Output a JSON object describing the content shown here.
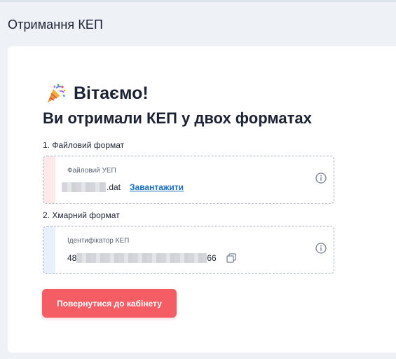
{
  "page": {
    "title": "Отримання КЕП"
  },
  "welcome": {
    "icon": "party-popper-icon",
    "heading": "Вітаємо!",
    "subtitle": "Ви отримали КЕП у двох форматах"
  },
  "file_format": {
    "section_label": "1. Файловий формат",
    "field_label": "Файловий УЕП",
    "file_extension": ".dat",
    "download_label": "Завантажити",
    "accent_color": "#fde9ea",
    "info_icon": "info-icon"
  },
  "cloud_format": {
    "section_label": "2. Хмарний формат",
    "field_label": "Ідентифікатор КЕП",
    "id_prefix": "48",
    "id_suffix": "66",
    "accent_color": "#e8f0fc",
    "copy_icon": "copy-icon",
    "info_icon": "info-icon"
  },
  "actions": {
    "back_label": "Повернутися до кабінету",
    "back_color": "#f45d63"
  },
  "colors": {
    "background": "#eef1f6",
    "card": "#ffffff",
    "link": "#1a6fbf",
    "text": "#1c2233"
  }
}
